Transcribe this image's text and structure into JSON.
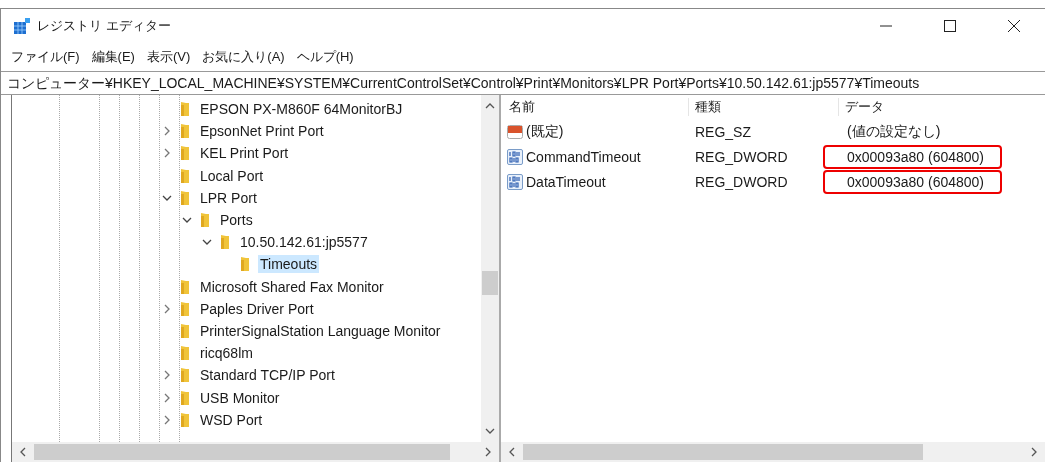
{
  "window": {
    "title": "レジストリ エディター"
  },
  "menu": [
    "ファイル(F)",
    "編集(E)",
    "表示(V)",
    "お気に入り(A)",
    "ヘルプ(H)"
  ],
  "address": "コンピューター¥HKEY_LOCAL_MACHINE¥SYSTEM¥CurrentControlSet¥Control¥Print¥Monitors¥LPR Port¥Ports¥10.50.142.61:jp5577¥Timeouts",
  "tree": [
    {
      "label": "EPSON PX-M860F 64MonitorBJ",
      "selected": false
    },
    {
      "label": "EpsonNet Print Port",
      "expanded": false,
      "selected": false
    },
    {
      "label": "KEL Print Port",
      "expanded": false,
      "selected": false
    },
    {
      "label": "Local Port",
      "selected": false
    },
    {
      "label": "LPR Port",
      "expanded": true,
      "selected": false,
      "children": [
        {
          "label": "Ports",
          "expanded": true,
          "selected": false,
          "children": [
            {
              "label": "10.50.142.61:jp5577",
              "expanded": true,
              "selected": false,
              "children": [
                {
                  "label": "Timeouts",
                  "selected": true
                }
              ]
            }
          ]
        }
      ]
    },
    {
      "label": "Microsoft Shared Fax Monitor",
      "selected": false
    },
    {
      "label": "Paples Driver Port",
      "expanded": false,
      "selected": false
    },
    {
      "label": "PrinterSignalStation Language Monitor",
      "selected": false
    },
    {
      "label": "ricq68lm",
      "selected": false
    },
    {
      "label": "Standard TCP/IP Port",
      "expanded": false,
      "selected": false
    },
    {
      "label": "USB Monitor",
      "expanded": false,
      "selected": false
    },
    {
      "label": "WSD Port",
      "expanded": false,
      "selected": false
    }
  ],
  "values": {
    "columns": [
      "名前",
      "種類",
      "データ"
    ],
    "rows": [
      {
        "kind": "string",
        "name": "(既定)",
        "type": "REG_SZ",
        "data": "(値の設定なし)",
        "highlighted": false
      },
      {
        "kind": "dword",
        "name": "CommandTimeout",
        "type": "REG_DWORD",
        "data": "0x00093a80 (604800)",
        "highlighted": true
      },
      {
        "kind": "dword",
        "name": "DataTimeout",
        "type": "REG_DWORD",
        "data": "0x00093a80 (604800)",
        "highlighted": true
      }
    ]
  }
}
